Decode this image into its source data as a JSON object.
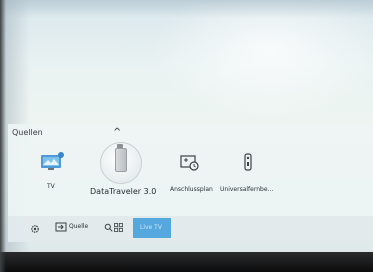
{
  "sources_panel": {
    "title": "Quellen",
    "items": [
      {
        "label": "TV",
        "icon": "tv-icon"
      },
      {
        "label": "DataTraveler 3.0",
        "icon": "usb-drive-icon"
      },
      {
        "label": "Anschlussplan",
        "icon": "connection-guide-icon"
      },
      {
        "label": "Universalfernbe...",
        "icon": "remote-icon"
      }
    ]
  },
  "bottom_bar": {
    "settings_icon": "gear-icon",
    "source_label": "Quelle",
    "search_icon": "search-icon",
    "apps_icon": "apps-icon",
    "highlighted_label": "Live TV"
  },
  "colors": {
    "accent": "#54a8de",
    "panel_bg": "#eef4f4",
    "text": "#2d3136"
  }
}
